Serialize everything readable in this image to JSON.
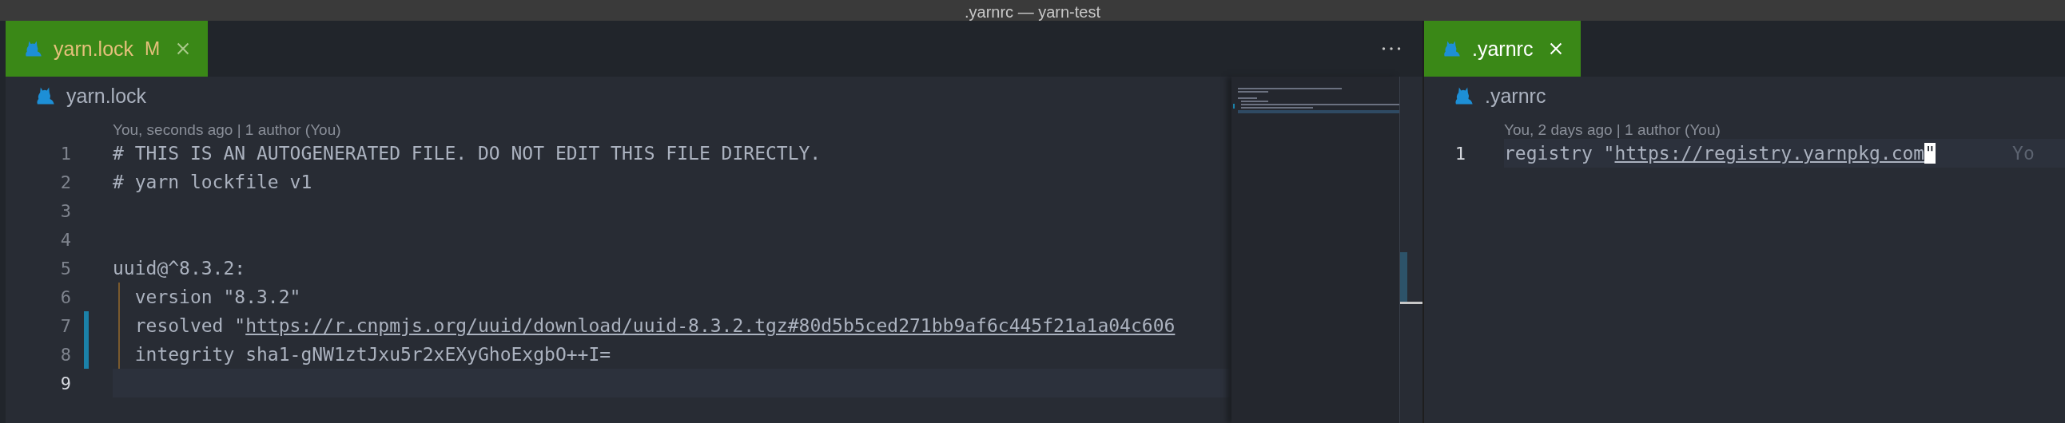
{
  "window": {
    "title": ".yarnrc — yarn-test"
  },
  "editor_groups": [
    {
      "tabs": [
        {
          "label": "yarn.lock",
          "badge": "M",
          "modified": true,
          "selected": true
        }
      ],
      "show_more_actions": true,
      "breadcrumb": "yarn.lock",
      "codelens": "You, seconds ago | 1 author (You)",
      "minimap": true,
      "lines": [
        {
          "number": "1",
          "text": "# THIS IS AN AUTOGENERATED FILE. DO NOT EDIT THIS FILE DIRECTLY.",
          "modified": false,
          "current": false,
          "indented": false
        },
        {
          "number": "2",
          "text": "# yarn lockfile v1",
          "modified": false,
          "current": false,
          "indented": false
        },
        {
          "number": "3",
          "modified": false,
          "current": false,
          "indented": false
        },
        {
          "number": "4",
          "modified": false,
          "current": false,
          "indented": false
        },
        {
          "number": "5",
          "text": "uuid@^8.3.2:",
          "modified": false,
          "current": false,
          "indented": false
        },
        {
          "number": "6",
          "text": "  version \"8.3.2\"",
          "modified": false,
          "current": false,
          "indented": true
        },
        {
          "number": "7",
          "text": "  resolved \"",
          "link": "https://r.cnpmjs.org/uuid/download/uuid-8.3.2.tgz#80d5b5ced271bb9af6c445f21a1a04c606",
          "modified": true,
          "current": false,
          "indented": true
        },
        {
          "number": "8",
          "text": "  integrity sha1-gNW1ztJxu5r2xEXyGhoExgbO++I=",
          "modified": true,
          "current": false,
          "indented": true
        },
        {
          "number": "9",
          "modified": false,
          "current": true,
          "indented": false
        }
      ]
    },
    {
      "tabs": [
        {
          "label": ".yarnrc",
          "modified": false,
          "selected": true
        }
      ],
      "show_more_actions": false,
      "breadcrumb": ".yarnrc",
      "codelens": "You, 2 days ago | 1 author (You)",
      "minimap": false,
      "lines": [
        {
          "number": "1",
          "text": "registry \"",
          "link": "https://registry.yarnpkg.com",
          "suffix": "\"",
          "cursor": true,
          "blame": "Yo",
          "modified": false,
          "current": true,
          "indented": false
        }
      ]
    }
  ]
}
